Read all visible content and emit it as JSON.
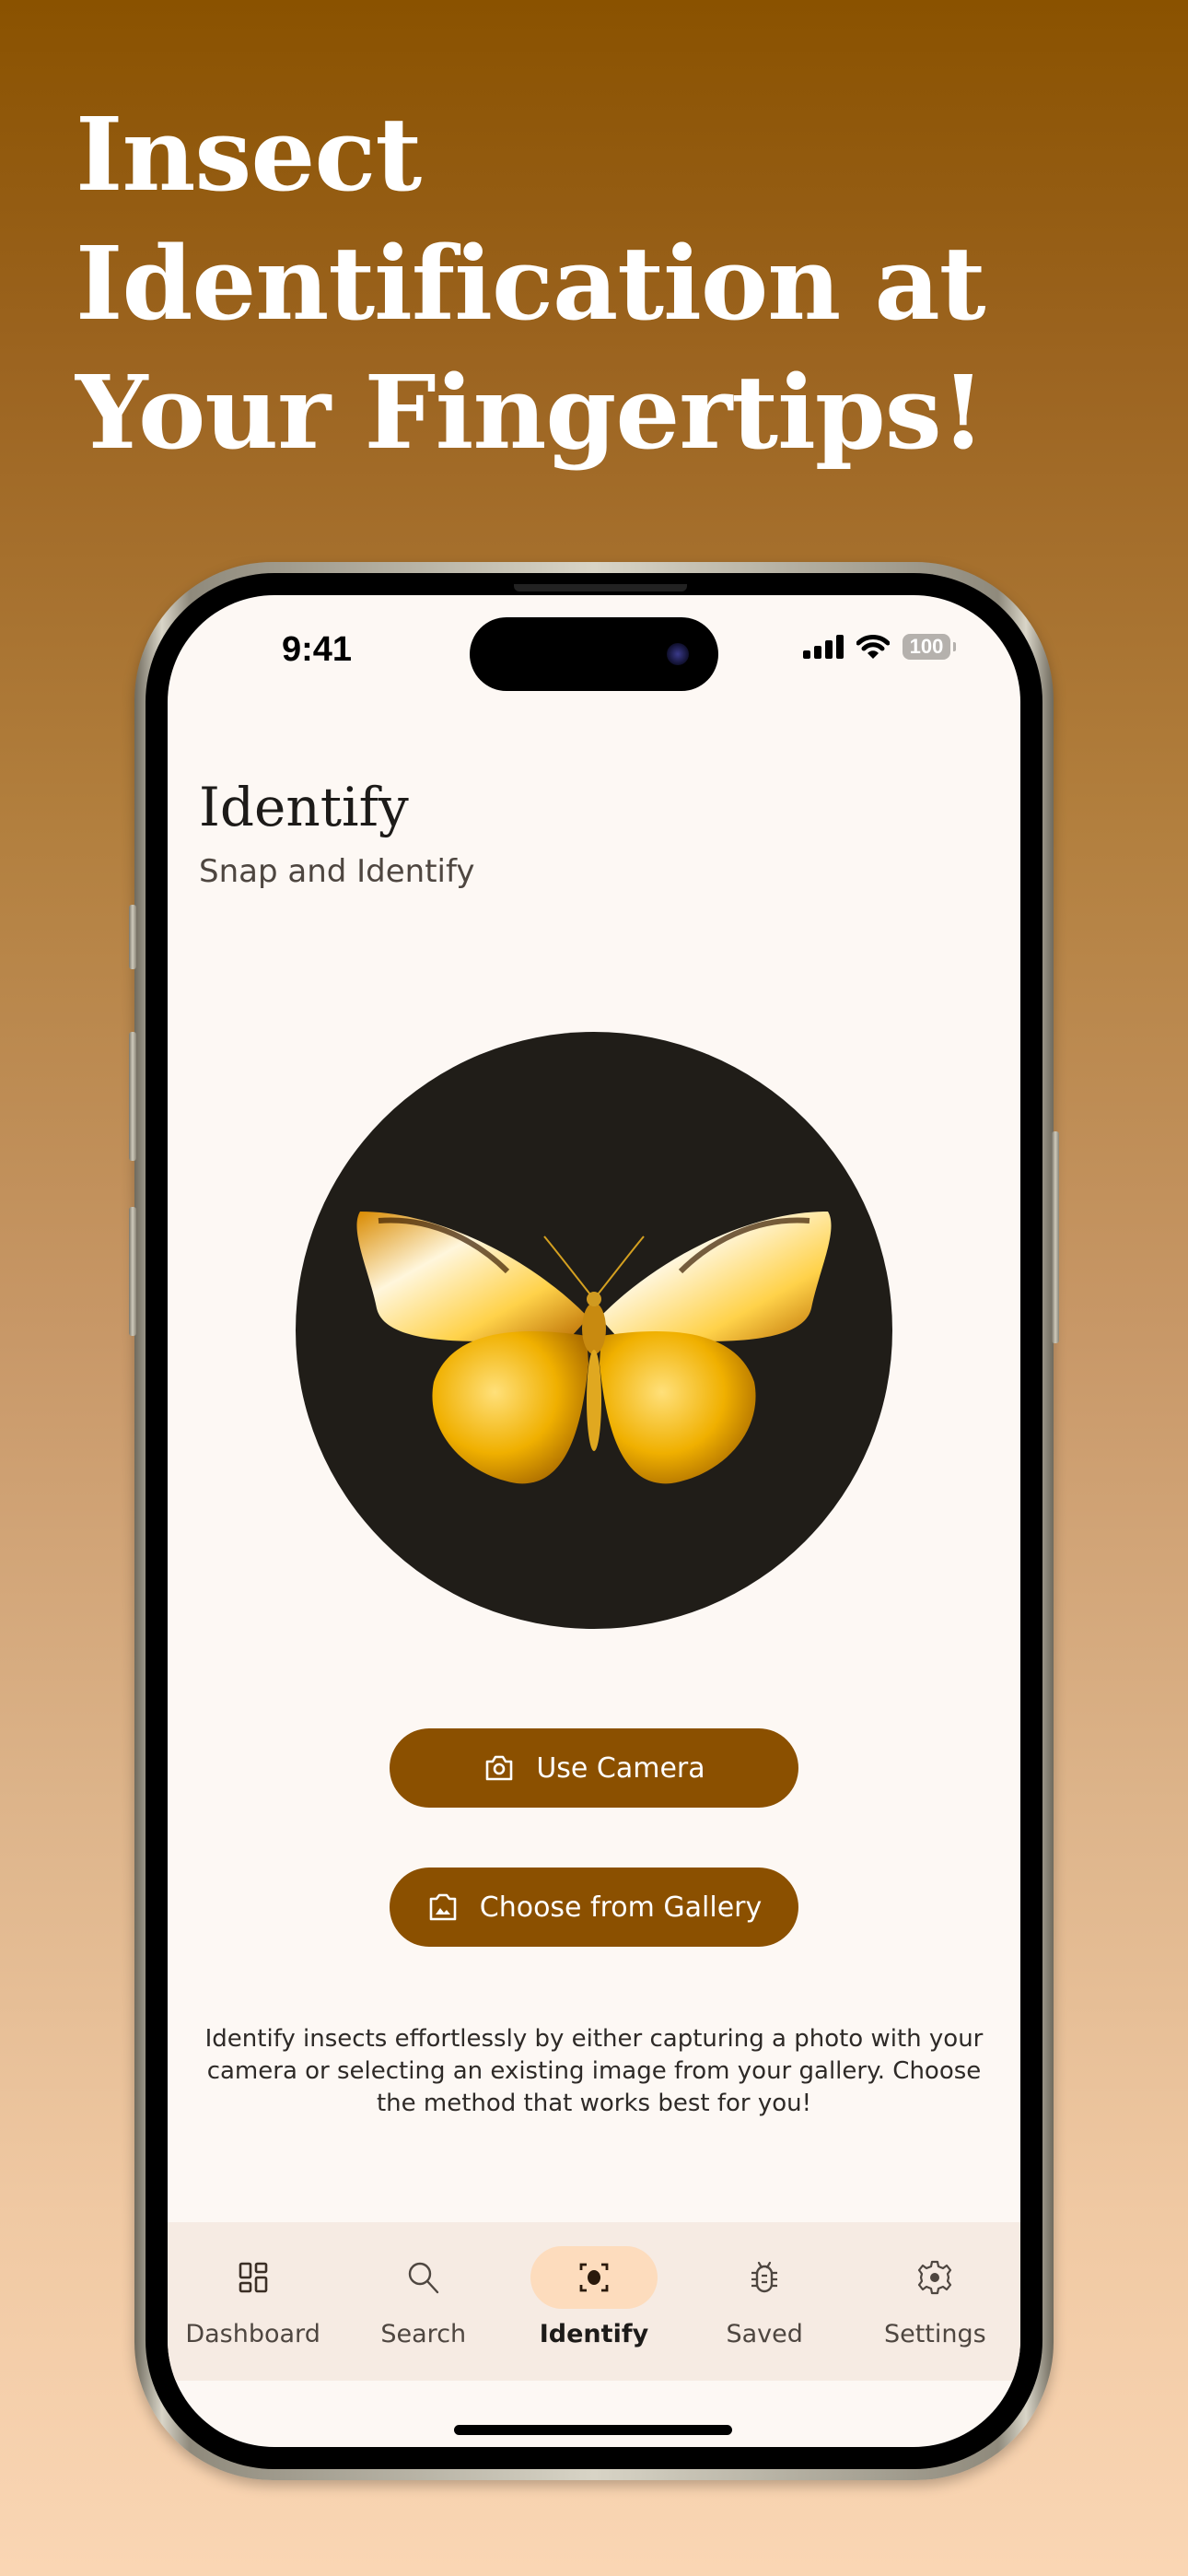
{
  "headline": {
    "lines": [
      "Insect",
      "Identification at",
      "Your Fingertips!"
    ]
  },
  "status_bar": {
    "time": "9:41",
    "battery": "100"
  },
  "screen": {
    "title": "Identify",
    "subtitle": "Snap and Identify",
    "hero_image": "golden-butterfly-illustration",
    "buttons": {
      "camera": {
        "label": "Use Camera",
        "icon": "camera-icon"
      },
      "gallery": {
        "label": "Choose from Gallery",
        "icon": "gallery-icon"
      }
    },
    "description": "Identify insects effortlessly by either capturing a photo with your camera or selecting an existing image from your gallery. Choose the method that works best for you!"
  },
  "bottom_nav": {
    "items": [
      {
        "label": "Dashboard",
        "icon": "dashboard-icon",
        "active": false
      },
      {
        "label": "Search",
        "icon": "search-icon",
        "active": false
      },
      {
        "label": "Identify",
        "icon": "identify-icon",
        "active": true
      },
      {
        "label": "Saved",
        "icon": "bug-icon",
        "active": false
      },
      {
        "label": "Settings",
        "icon": "gear-icon",
        "active": false
      }
    ]
  },
  "colors": {
    "primary": "#8b5000",
    "active_pill": "#fddcbd",
    "screen_bg": "#fdf8f4",
    "nav_bg": "#f6ebe3"
  }
}
